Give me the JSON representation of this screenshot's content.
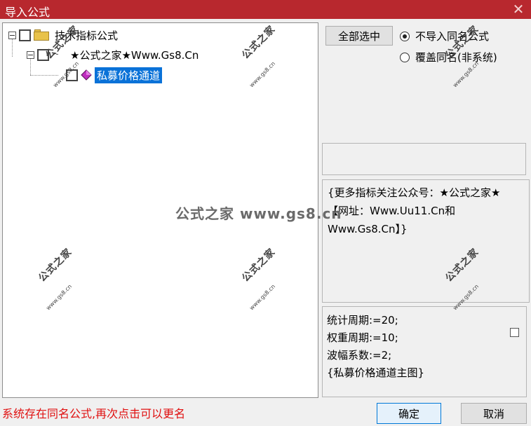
{
  "window": {
    "title": "导入公式",
    "close_glyph": "✕"
  },
  "tree": {
    "root": {
      "label": "技术指标公式",
      "expanded": true,
      "checked": false,
      "icon": "folder-icon"
    },
    "group": {
      "label": "★公式之家★Www.Gs8.Cn",
      "expanded": true,
      "checked": false
    },
    "item": {
      "label": "私募价格通道",
      "checked": false,
      "selected": true,
      "icon": "formula-icon"
    }
  },
  "actions": {
    "select_all_label": "全部选中"
  },
  "import_mode": {
    "options": [
      {
        "label": "不导入同名公式",
        "selected": true
      },
      {
        "label": "覆盖同名(非系统)",
        "selected": false
      }
    ]
  },
  "description": {
    "text": "{更多指标关注公众号：★公式之家★ 【网址：Www.Uu11.Cn和Www.Gs8.Cn】}"
  },
  "parameters": {
    "lines": [
      "统计周期:=20;",
      "权重周期:=10;",
      "波幅系数:=2;",
      "{私募价格通道主图}"
    ],
    "checkbox_checked": false
  },
  "status": {
    "message": "系统存在同名公式,再次点击可以更名"
  },
  "buttons": {
    "ok": "确定",
    "cancel": "取消"
  },
  "watermark": {
    "logo": "公式之家",
    "site": "www.gs8.cn",
    "banner": "公式之家 www.gs8.cn"
  },
  "colors": {
    "titlebar": "#b8282e",
    "selection": "#0a72d8",
    "status_text": "#e01010"
  }
}
